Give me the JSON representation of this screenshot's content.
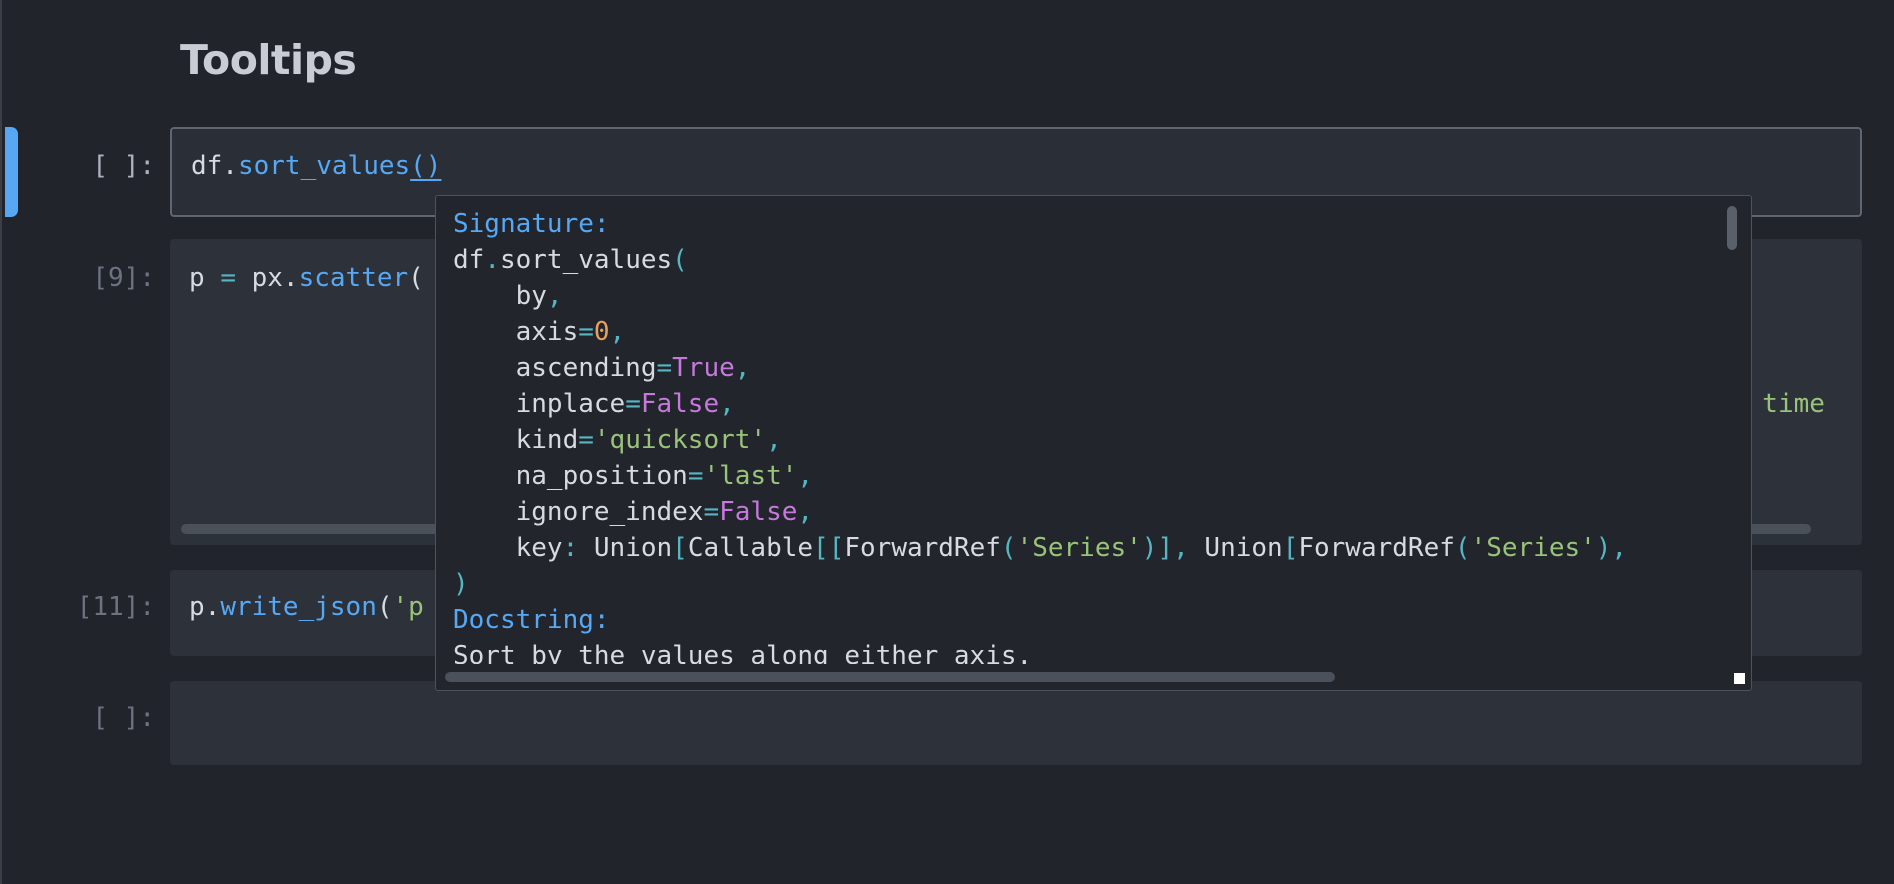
{
  "title": "Tooltips",
  "cells": [
    {
      "prompt": "[ ]:",
      "code": [
        {
          "t": "df.",
          "c": ""
        },
        {
          "t": "sort_values",
          "c": "t-fn"
        },
        {
          "t": "()",
          "c": "t-fn paren-under"
        }
      ]
    },
    {
      "prompt": "[9]:",
      "code": [
        {
          "t": "p ",
          "c": ""
        },
        {
          "t": "=",
          "c": "t-op"
        },
        {
          "t": " px.",
          "c": ""
        },
        {
          "t": "scatter",
          "c": "t-fn"
        },
        {
          "t": "(",
          "c": ""
        }
      ],
      "overflow_text": "r time"
    },
    {
      "prompt": "[11]:",
      "code": [
        {
          "t": "p.",
          "c": ""
        },
        {
          "t": "write_json",
          "c": "t-fn"
        },
        {
          "t": "(",
          "c": ""
        },
        {
          "t": "'p",
          "c": "t-str"
        }
      ]
    },
    {
      "prompt": "[ ]:",
      "code": []
    }
  ],
  "tooltip": {
    "lines": [
      [
        {
          "t": "Signature:",
          "c": "t-head"
        }
      ],
      [
        {
          "t": "df",
          "c": ""
        },
        {
          "t": ".",
          "c": "t-op"
        },
        {
          "t": "sort_values",
          "c": ""
        },
        {
          "t": "(",
          "c": "t-op"
        }
      ],
      [
        {
          "t": "    by",
          "c": ""
        },
        {
          "t": ",",
          "c": "t-op"
        }
      ],
      [
        {
          "t": "    axis",
          "c": ""
        },
        {
          "t": "=",
          "c": "t-op"
        },
        {
          "t": "0",
          "c": "t-num"
        },
        {
          "t": ",",
          "c": "t-op"
        }
      ],
      [
        {
          "t": "    ascending",
          "c": ""
        },
        {
          "t": "=",
          "c": "t-op"
        },
        {
          "t": "True",
          "c": "t-kw"
        },
        {
          "t": ",",
          "c": "t-op"
        }
      ],
      [
        {
          "t": "    inplace",
          "c": ""
        },
        {
          "t": "=",
          "c": "t-op"
        },
        {
          "t": "False",
          "c": "t-kw"
        },
        {
          "t": ",",
          "c": "t-op"
        }
      ],
      [
        {
          "t": "    kind",
          "c": ""
        },
        {
          "t": "=",
          "c": "t-op"
        },
        {
          "t": "'quicksort'",
          "c": "t-str"
        },
        {
          "t": ",",
          "c": "t-op"
        }
      ],
      [
        {
          "t": "    na_position",
          "c": ""
        },
        {
          "t": "=",
          "c": "t-op"
        },
        {
          "t": "'last'",
          "c": "t-str"
        },
        {
          "t": ",",
          "c": "t-op"
        }
      ],
      [
        {
          "t": "    ignore_index",
          "c": ""
        },
        {
          "t": "=",
          "c": "t-op"
        },
        {
          "t": "False",
          "c": "t-kw"
        },
        {
          "t": ",",
          "c": "t-op"
        }
      ],
      [
        {
          "t": "    key",
          "c": ""
        },
        {
          "t": ":",
          "c": "t-op"
        },
        {
          "t": " Union",
          "c": ""
        },
        {
          "t": "[",
          "c": "t-op"
        },
        {
          "t": "Callable",
          "c": ""
        },
        {
          "t": "[[",
          "c": "t-op"
        },
        {
          "t": "ForwardRef",
          "c": ""
        },
        {
          "t": "(",
          "c": "t-op"
        },
        {
          "t": "'Series'",
          "c": "t-str"
        },
        {
          "t": ")],",
          "c": "t-op"
        },
        {
          "t": " Union",
          "c": ""
        },
        {
          "t": "[",
          "c": "t-op"
        },
        {
          "t": "ForwardRef",
          "c": ""
        },
        {
          "t": "(",
          "c": "t-op"
        },
        {
          "t": "'Series'",
          "c": "t-str"
        },
        {
          "t": "),",
          "c": "t-op"
        },
        {
          "t": " ",
          "c": ""
        }
      ],
      [
        {
          "t": ")",
          "c": "t-op"
        }
      ],
      [
        {
          "t": "Docstring:",
          "c": "t-head"
        }
      ],
      [
        {
          "t": "Sort by the values along either axis.",
          "c": ""
        }
      ]
    ]
  }
}
